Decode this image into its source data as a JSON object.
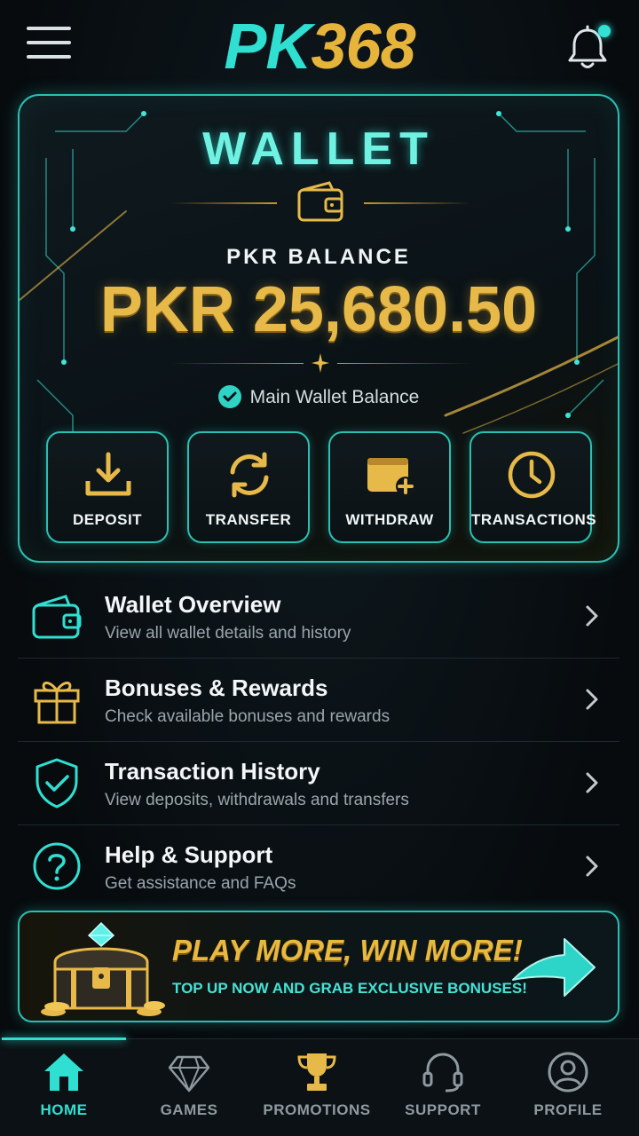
{
  "app": {
    "logo_pk": "PK",
    "logo_num": "368",
    "has_notification": true
  },
  "wallet": {
    "title": "WALLET",
    "balance_label": "PKR BALANCE",
    "balance_value": "PKR 25,680.50",
    "main_wallet_label": "Main Wallet Balance",
    "actions": [
      {
        "label": "DEPOSIT",
        "icon": "download-tray-icon"
      },
      {
        "label": "TRANSFER",
        "icon": "refresh-arrows-icon"
      },
      {
        "label": "WITHDRAW",
        "icon": "wallet-plus-icon"
      },
      {
        "label": "TRANSACTIONS",
        "icon": "clock-icon"
      }
    ]
  },
  "menu": [
    {
      "title": "Wallet Overview",
      "subtitle": "View all wallet details and history",
      "icon": "wallet-icon"
    },
    {
      "title": "Bonuses & Rewards",
      "subtitle": "Check available bonuses and rewards",
      "icon": "gift-icon"
    },
    {
      "title": "Transaction History",
      "subtitle": "View deposits, withdrawals and transfers",
      "icon": "shield-check-icon"
    },
    {
      "title": "Help & Support",
      "subtitle": "Get assistance and FAQs",
      "icon": "question-circle-icon"
    }
  ],
  "promo": {
    "title": "PLAY MORE, WIN MORE!",
    "subtitle": "TOP UP NOW AND GRAB EXCLUSIVE BONUSES!"
  },
  "nav": [
    {
      "label": "HOME",
      "icon": "home-icon",
      "active": true
    },
    {
      "label": "GAMES",
      "icon": "diamond-icon",
      "active": false
    },
    {
      "label": "PROMOTIONS",
      "icon": "trophy-icon",
      "active": false
    },
    {
      "label": "SUPPORT",
      "icon": "headset-icon",
      "active": false
    },
    {
      "label": "PROFILE",
      "icon": "user-circle-icon",
      "active": false
    }
  ],
  "colors": {
    "accent_teal": "#2fe0d2",
    "accent_gold": "#e7b948",
    "background": "#0a1014"
  }
}
